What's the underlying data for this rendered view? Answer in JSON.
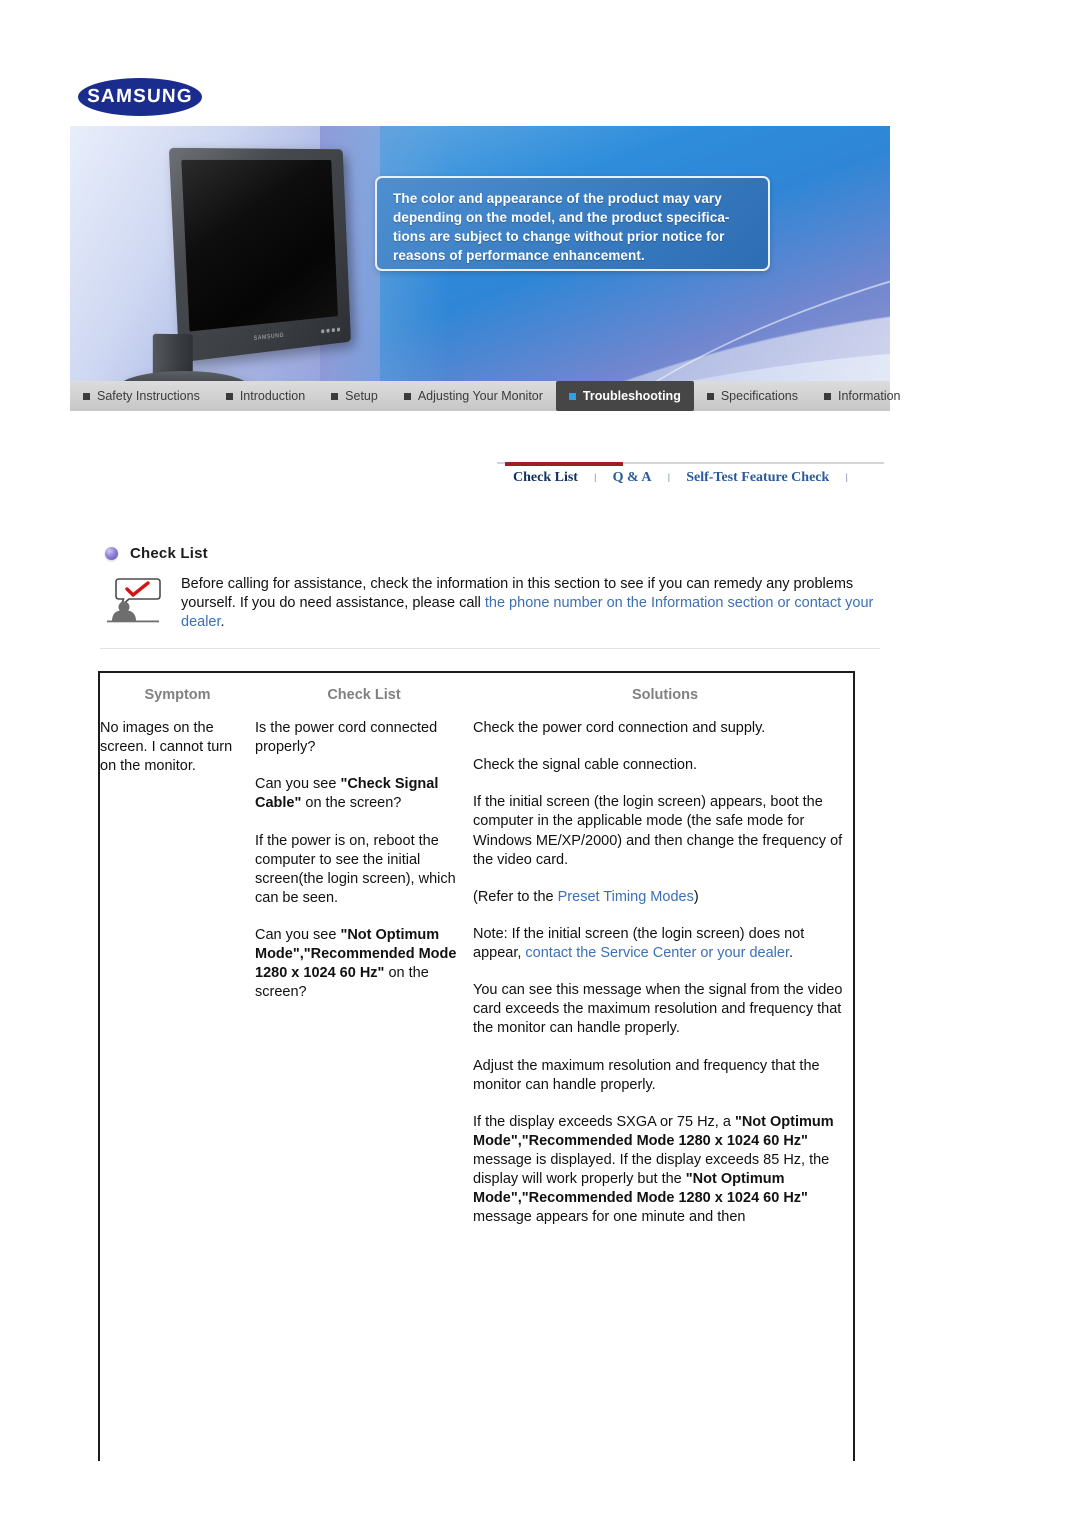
{
  "brand": {
    "logo_text": "SAMSUNG",
    "logo_color": "#1b2c8f"
  },
  "banner": {
    "notice": "The color and appearance of the product may vary depending on the model, and the product specifica-tions are subject to change without prior notice for reasons of performance enhancement.",
    "monitor_brand_label": "SAMSUNG"
  },
  "nav": {
    "items": [
      {
        "label": "Safety Instructions",
        "active": false
      },
      {
        "label": "Introduction",
        "active": false
      },
      {
        "label": "Setup",
        "active": false
      },
      {
        "label": "Adjusting Your Monitor",
        "active": false
      },
      {
        "label": "Troubleshooting",
        "active": true
      },
      {
        "label": "Specifications",
        "active": false
      },
      {
        "label": "Information",
        "active": false
      }
    ]
  },
  "subtabs": {
    "items": [
      {
        "label": "Check List",
        "active": true
      },
      {
        "label": "Q & A",
        "active": false
      },
      {
        "label": "Self-Test Feature Check",
        "active": false
      }
    ],
    "separator": "l",
    "active_underline_color": "#9c1f23"
  },
  "section": {
    "title": "Check List",
    "intro_part1": "Before calling for assistance, check the information in this section to see if you can remedy any problems yourself. If you do need assistance, please call ",
    "intro_link": "the phone number on the Information section or contact your dealer",
    "intro_part2": "."
  },
  "table": {
    "headers": [
      "Symptom",
      "Check List",
      "Solutions"
    ],
    "rows": [
      {
        "symptom": "No images on the screen. I cannot turn on the monitor.",
        "checks": [
          {
            "parts": [
              {
                "t": "Is the power cord connected properly?",
                "bold": false
              }
            ]
          },
          {
            "parts": [
              {
                "t": "Can you see ",
                "bold": false
              },
              {
                "t": "\"Check Signal Cable\"",
                "bold": true
              },
              {
                "t": " on the screen?",
                "bold": false
              }
            ]
          },
          {
            "parts": [
              {
                "t": "If the power is on, reboot the computer to see the initial screen(the login screen), which can be seen.",
                "bold": false
              }
            ]
          },
          {
            "parts": [
              {
                "t": "Can you see ",
                "bold": false
              },
              {
                "t": "\"Not Optimum Mode\",\"Recommended Mode 1280 x 1024 60 Hz\"",
                "bold": true
              },
              {
                "t": " on the screen?",
                "bold": false
              }
            ]
          }
        ],
        "solutions": [
          {
            "parts": [
              {
                "t": "Check the power cord connection and supply.",
                "bold": false
              }
            ]
          },
          {
            "parts": [
              {
                "t": "Check the signal cable connection.",
                "bold": false
              }
            ]
          },
          {
            "parts": [
              {
                "t": "If the initial screen (the login screen) appears, boot the computer in the applicable mode (the safe mode for Windows ME/XP/2000) and then change the frequency of the video card.",
                "bold": false
              }
            ]
          },
          {
            "parts": [
              {
                "t": "(Refer to the ",
                "bold": false
              },
              {
                "t": "Preset Timing Modes",
                "bold": false,
                "link": true
              },
              {
                "t": ")",
                "bold": false
              }
            ]
          },
          {
            "parts": [
              {
                "t": "Note: If the initial screen (the login screen) does not appear, ",
                "bold": false
              },
              {
                "t": "contact the Service Center or your dealer",
                "bold": false,
                "link": true
              },
              {
                "t": ".",
                "bold": false
              }
            ]
          },
          {
            "parts": [
              {
                "t": "You can see this message when the signal from the video card exceeds the maximum resolution and frequency that the monitor can handle properly.",
                "bold": false
              }
            ]
          },
          {
            "parts": [
              {
                "t": "Adjust the maximum resolution and frequency that the monitor can handle properly.",
                "bold": false
              }
            ]
          },
          {
            "parts": [
              {
                "t": "If the display exceeds SXGA or 75 Hz, a ",
                "bold": false
              },
              {
                "t": "\"Not Optimum Mode\",\"Recommended Mode 1280 x 1024 60 Hz\"",
                "bold": true
              },
              {
                "t": " message is displayed. If the display exceeds 85 Hz, the display will work properly but the ",
                "bold": false
              },
              {
                "t": "\"Not Optimum Mode\",\"Recommended Mode 1280 x 1024 60 Hz\"",
                "bold": true
              },
              {
                "t": " message appears for one minute and then",
                "bold": false
              }
            ]
          }
        ]
      }
    ]
  }
}
